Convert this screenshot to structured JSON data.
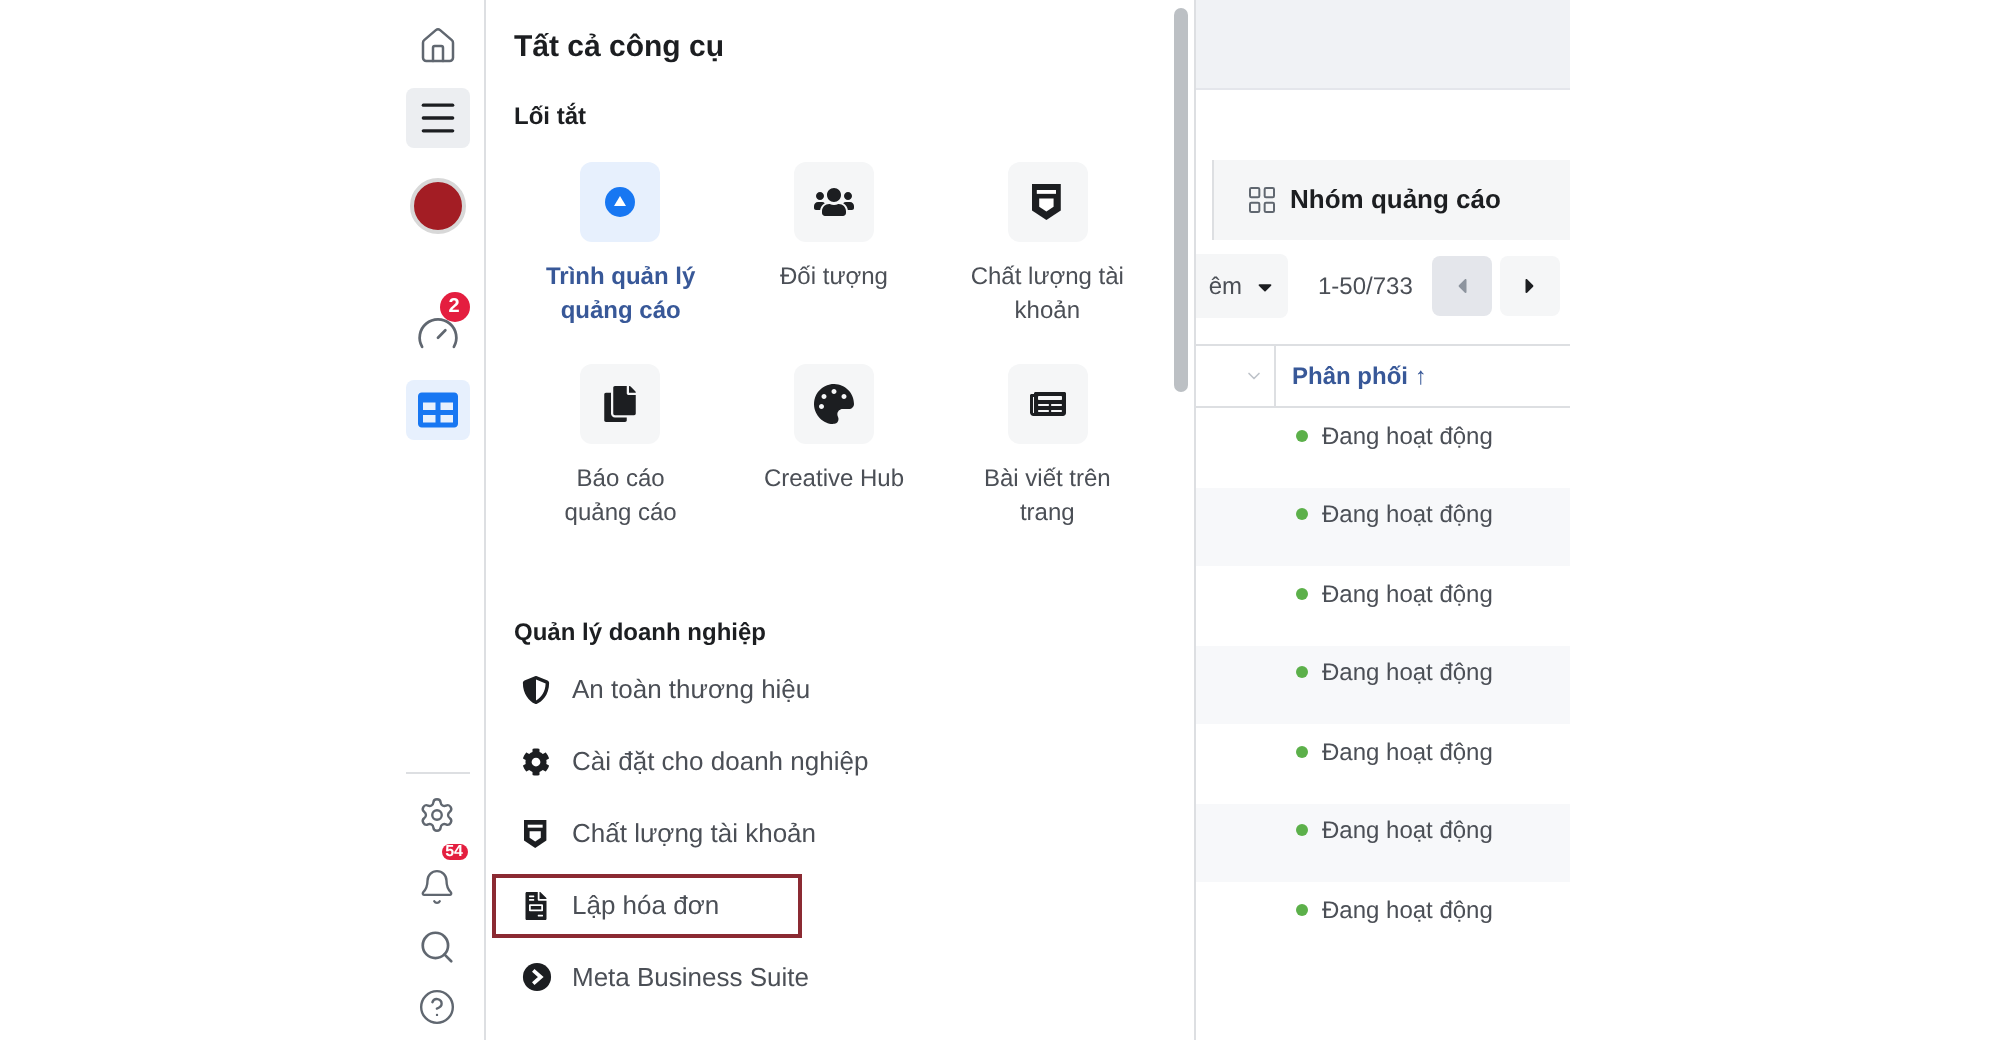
{
  "rail": {
    "top": [
      {
        "kind": "home",
        "selected": false
      },
      {
        "kind": "menu",
        "selected": true
      },
      {
        "kind": "avatar",
        "selected": false
      },
      {
        "kind": "gauge",
        "selected": false,
        "badge": "2"
      },
      {
        "kind": "table",
        "selected": true
      }
    ],
    "bottom": [
      {
        "kind": "settings"
      },
      {
        "kind": "bell",
        "badge": "54"
      },
      {
        "kind": "search"
      },
      {
        "kind": "help"
      }
    ]
  },
  "panel": {
    "title": "Tất cả công cụ",
    "shortcuts": {
      "heading": "Lối tắt",
      "items": [
        {
          "label": "Trình quản lý quảng cáo",
          "selected": true
        },
        {
          "label": "Đối tượng",
          "selected": false
        },
        {
          "label": "Chất lượng tài khoản",
          "selected": false
        },
        {
          "label": "Báo cáo quảng cáo",
          "selected": false
        },
        {
          "label": "Creative Hub",
          "selected": false
        },
        {
          "label": "Bài viết trên trang",
          "selected": false
        }
      ]
    },
    "business": {
      "heading": "Quản lý doanh nghiệp",
      "items": [
        {
          "label": "An toàn thương hiệu",
          "highlighted": false
        },
        {
          "label": "Cài đặt cho doanh nghiệp",
          "highlighted": false
        },
        {
          "label": "Chất lượng tài khoản",
          "highlighted": false
        },
        {
          "label": "Lập hóa đơn",
          "highlighted": true
        },
        {
          "label": "Meta Business Suite",
          "highlighted": false
        }
      ]
    }
  },
  "content": {
    "tab": "Nhóm quảng cáo",
    "toolbar": {
      "dropdown": "êm",
      "range": "1-50/733",
      "prev_disabled": true
    },
    "table": {
      "column": "Phân phối ↑",
      "rows": [
        {
          "status": "Đang hoạt động",
          "color": "#5cb04a"
        },
        {
          "status": "Đang hoạt động",
          "color": "#5cb04a"
        },
        {
          "status": "Đang hoạt động",
          "color": "#5cb04a"
        },
        {
          "status": "Đang hoạt động",
          "color": "#5cb04a"
        },
        {
          "status": "Đang hoạt động",
          "color": "#5cb04a"
        },
        {
          "status": "Đang hoạt động",
          "color": "#5cb04a"
        },
        {
          "status": "Đang hoạt động",
          "color": "#5cb04a"
        }
      ]
    }
  }
}
